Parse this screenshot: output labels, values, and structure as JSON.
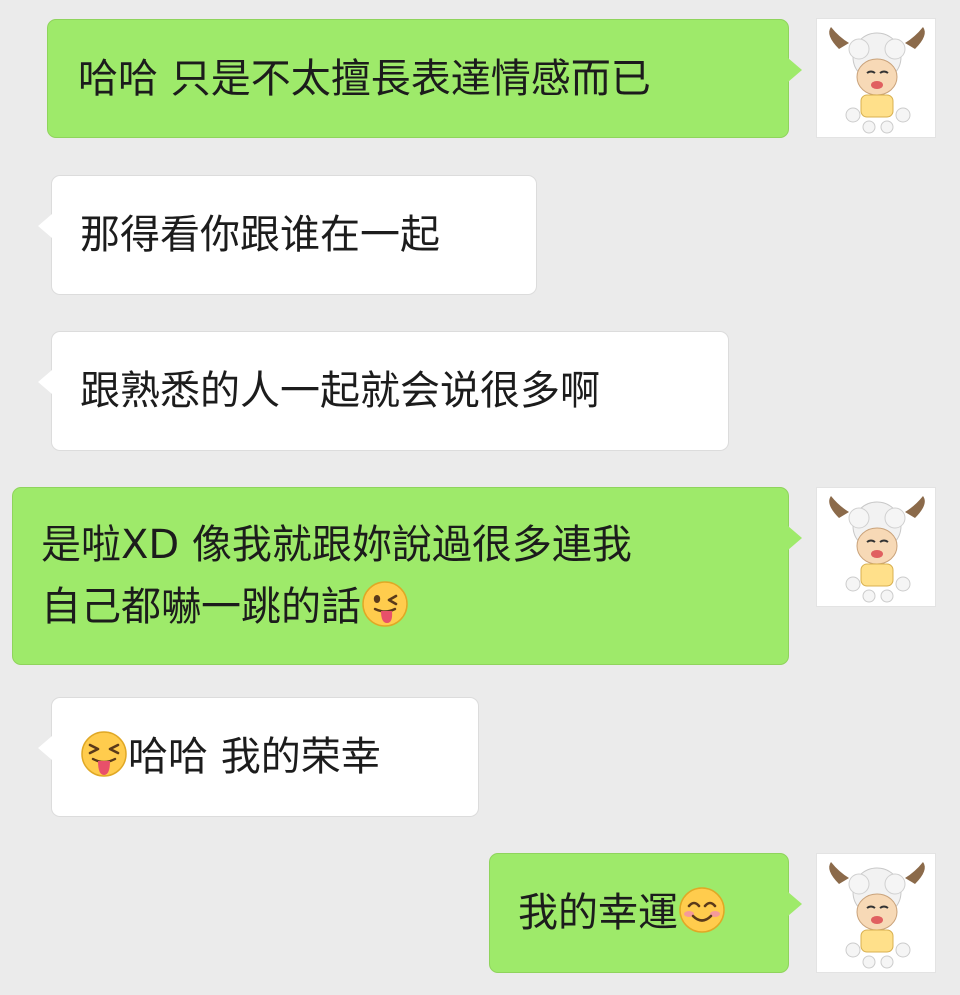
{
  "chat": {
    "messages": [
      {
        "sender": "me",
        "text": "哈哈  只是不太擅長表達情感而已"
      },
      {
        "sender": "other",
        "text": "那得看你跟谁在一起"
      },
      {
        "sender": "other",
        "text": "跟熟悉的人一起就会说很多啊"
      },
      {
        "sender": "me",
        "line1": "是啦XD  像我就跟妳說過很多連我",
        "line2": "自己都嚇一跳的話",
        "emoji": "winking-tongue-face"
      },
      {
        "sender": "other",
        "text": "哈哈  我的荣幸",
        "emoji": "squinting-tongue-face"
      },
      {
        "sender": "me",
        "text": "我的幸運",
        "emoji": "smiling-face-with-smiling-eyes"
      }
    ],
    "avatar_icon": "cartoon-sheep-avatar",
    "colors": {
      "background": "#ebebeb",
      "sent_bubble": "#9eea6a",
      "received_bubble": "#ffffff"
    }
  }
}
